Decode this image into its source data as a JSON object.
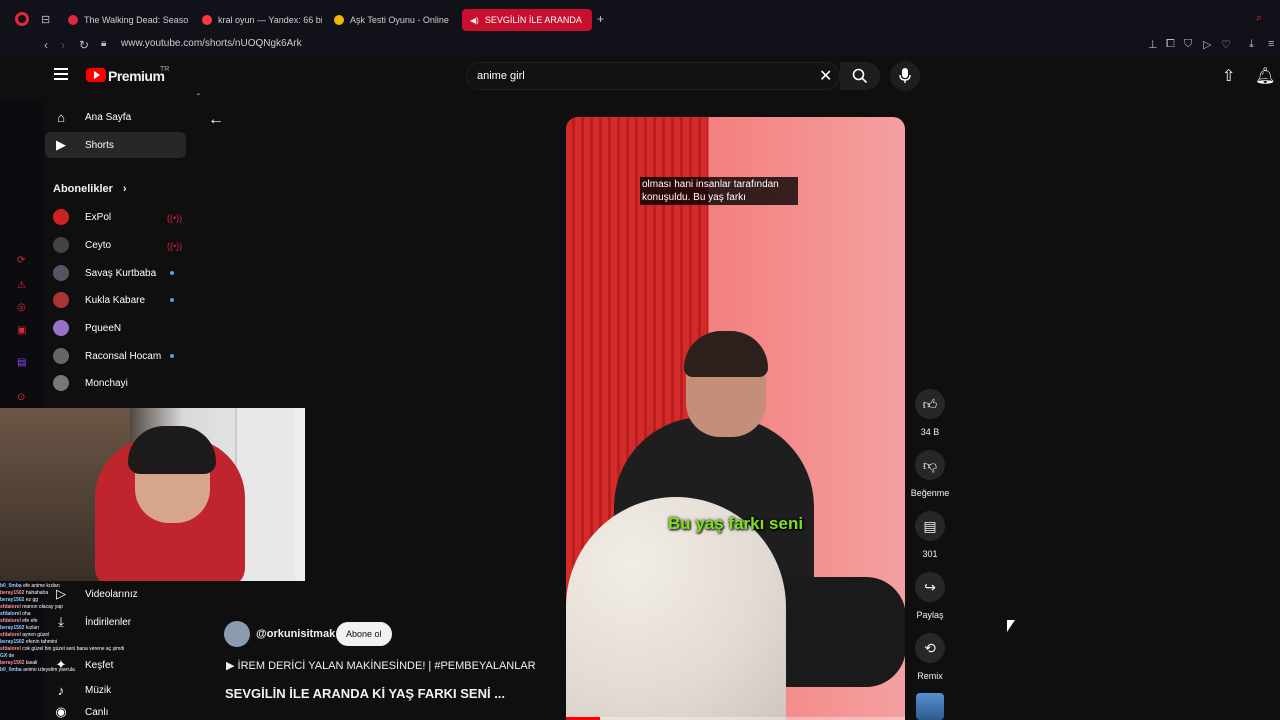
{
  "browser": {
    "tabs": [
      {
        "label": "The Walking Dead: Season",
        "color": "#e0283c"
      },
      {
        "label": "kral oyun — Yandex: 66 bi",
        "color": "#ff3a3a"
      },
      {
        "label": "Aşk Testi Oyunu - Online",
        "color": "#f2b705"
      },
      {
        "label": "SEVGİLİN İLE ARANDA",
        "color": "#ffffff"
      }
    ],
    "new_tab": "+",
    "url": "www.youtube.com/shorts/nUOQNgk6Ark"
  },
  "youtube": {
    "brand": "Premium",
    "region": "TR",
    "search_value": "anime girl",
    "sidebar": {
      "items": [
        {
          "label": "Ana Sayfa",
          "icon": "home-icon"
        },
        {
          "label": "Shorts",
          "icon": "shorts-icon"
        }
      ],
      "subscriptions_title": "Abonelikler",
      "subscriptions": [
        {
          "label": "ExPol",
          "status": "live",
          "color": "#c22"
        },
        {
          "label": "Ceyto",
          "status": "live",
          "color": "#444"
        },
        {
          "label": "Savaş Kurtbaba",
          "status": "new",
          "color": "#556"
        },
        {
          "label": "Kukla Kabare",
          "status": "new",
          "color": "#a33"
        },
        {
          "label": "PqueeN",
          "status": "",
          "color": "#9a6fc7"
        },
        {
          "label": "Raconsal Hocam",
          "status": "new",
          "color": "#666"
        },
        {
          "label": "Monchayi",
          "status": "",
          "color": "#777"
        }
      ],
      "lower_items": [
        {
          "label": "Videolarınız"
        },
        {
          "label": "İndirilenler"
        },
        {
          "label": "Keşfet"
        },
        {
          "label": "Müzik"
        },
        {
          "label": "Canlı"
        }
      ]
    },
    "short": {
      "subtitle_top": "olması hani insanlar tarafından konuşuldu. Bu yaş farkı",
      "subtitle_main": "Bu yaş farkı seni",
      "progress_fraction": 0.1,
      "channel": "@orkunisitmak",
      "subscribe_label": "Abone ol",
      "music": "İREM DERİCİ YALAN MAKİNESİNDE! | #PEMBEYALANLAR",
      "title": "SEVGİLİN İLE ARANDA Kİ YAŞ FARKI SENİ ...",
      "actions": {
        "like_count": "34 B",
        "dislike_label": "Beğenme",
        "comments_count": "301",
        "share_label": "Paylaş",
        "remix_label": "Remix"
      }
    }
  },
  "stream_chat": [
    {
      "user": "b0_0mba",
      "msg": "efe anime kızları"
    },
    {
      "user": "beray1502",
      "msg": "hahahaha"
    },
    {
      "user": "beray1502",
      "msg": "ez gg"
    },
    {
      "user": "sfdalorel",
      "msg": "manon olacay yap"
    },
    {
      "user": "sfdalorel",
      "msg": "oha"
    },
    {
      "user": "sfdalorel",
      "msg": "efe efe"
    },
    {
      "user": "beray1502",
      "msg": "kızları"
    },
    {
      "user": "sfdalorel",
      "msg": "aynen güzel"
    },
    {
      "user": "beray1502",
      "msg": "efenin tahmini"
    },
    {
      "user": "sfdalorel",
      "msg": "cok güzel bin güzel seni bana verene aç şimdi"
    },
    {
      "user": "GX",
      "msg": "de"
    },
    {
      "user": "beray1502",
      "msg": "lasali"
    },
    {
      "user": "b0_0mba",
      "msg": "animo izleyelim yavrula"
    }
  ]
}
